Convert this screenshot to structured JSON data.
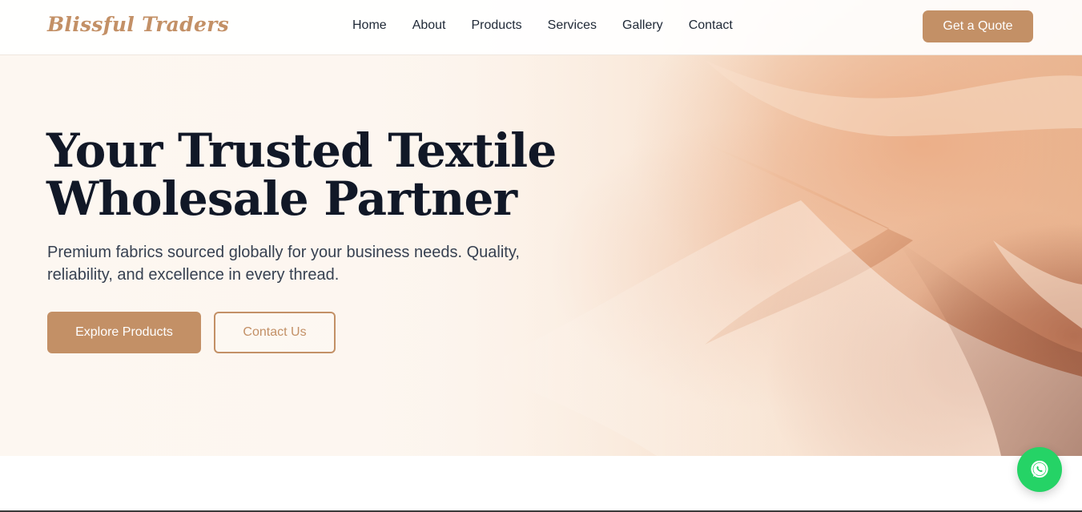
{
  "brand": {
    "name": "Blissful Traders",
    "accent": "#c39066",
    "whatsapp_color": "#25d366"
  },
  "nav": {
    "items": [
      {
        "label": "Home"
      },
      {
        "label": "About"
      },
      {
        "label": "Products"
      },
      {
        "label": "Services"
      },
      {
        "label": "Gallery"
      },
      {
        "label": "Contact"
      }
    ],
    "cta_label": "Get a Quote"
  },
  "hero": {
    "title": "Your Trusted Textile Wholesale Partner",
    "subtitle": "Premium fabrics sourced globally for your business needs. Quality, reliability, and excellence in every thread.",
    "primary_button": "Explore Products",
    "secondary_button": "Contact Us",
    "background_image": "peach-fabric-folds"
  },
  "floating": {
    "icon": "whatsapp-icon"
  }
}
